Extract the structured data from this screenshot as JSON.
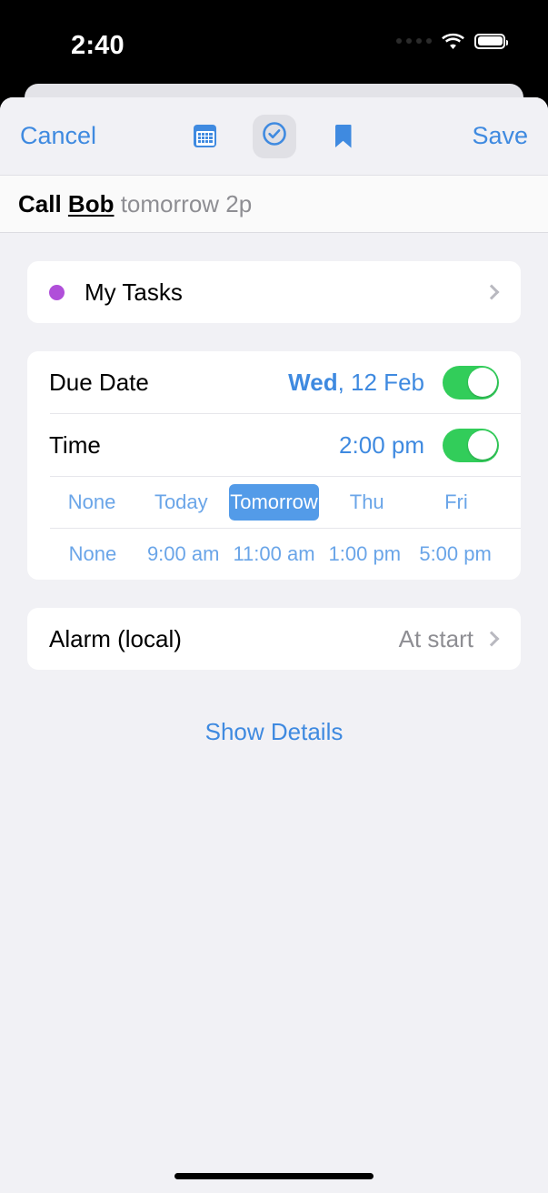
{
  "status_bar": {
    "time": "2:40",
    "icons": [
      "cellular-dots",
      "wifi-icon",
      "battery-icon"
    ]
  },
  "toolbar": {
    "cancel_label": "Cancel",
    "save_label": "Save",
    "icons": [
      {
        "name": "calendar-icon",
        "selected": false
      },
      {
        "name": "check-circle-icon",
        "selected": true
      },
      {
        "name": "bookmark-icon",
        "selected": false
      }
    ],
    "accent_color": "#3f8ae0"
  },
  "title_input": {
    "verb": "Call",
    "entity": "Bob",
    "remainder": "tomorrow 2p",
    "full_text": "Call Bob tomorrow 2p"
  },
  "list_card": {
    "list_name": "My Tasks",
    "list_color": "#b04fd9",
    "chevron": "chevron-right-icon"
  },
  "schedule_card": {
    "due_date": {
      "label": "Due Date",
      "value_bold": "Wed",
      "value_rest": ", 12 Feb",
      "enabled": true
    },
    "time": {
      "label": "Time",
      "value": "2:00 pm",
      "enabled": true
    },
    "date_chips": [
      {
        "label": "None",
        "active": false
      },
      {
        "label": "Today",
        "active": false
      },
      {
        "label": "Tomorrow",
        "active": true
      },
      {
        "label": "Thu",
        "active": false
      },
      {
        "label": "Fri",
        "active": false
      }
    ],
    "time_chips": [
      {
        "label": "None",
        "active": false
      },
      {
        "label": "9:00 am",
        "active": false
      },
      {
        "label": "11:00 am",
        "active": false
      },
      {
        "label": "1:00 pm",
        "active": false
      },
      {
        "label": "5:00 pm",
        "active": false
      }
    ],
    "toggle_on_color": "#32cd5a",
    "chip_active_color": "#539be8"
  },
  "alarm_card": {
    "label": "Alarm (local)",
    "value": "At start",
    "chevron": "chevron-right-icon"
  },
  "show_details": {
    "label": "Show Details"
  }
}
